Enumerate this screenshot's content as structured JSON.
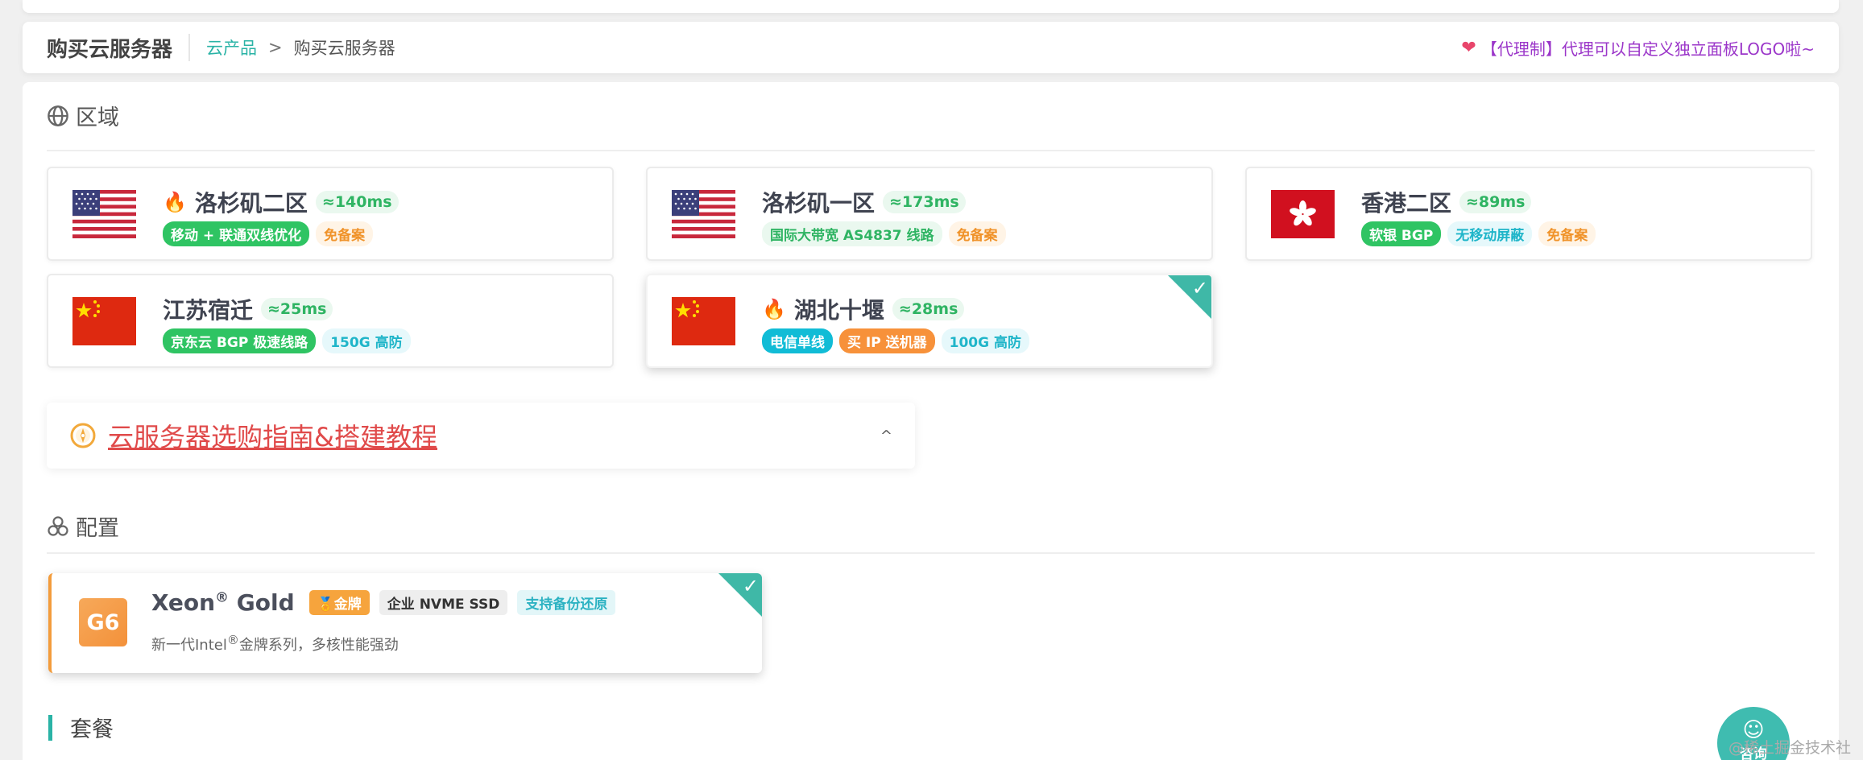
{
  "header": {
    "title": "购买云服务器",
    "breadcrumb_link": "云产品",
    "breadcrumb_arrow": ">",
    "breadcrumb_current": "购买云服务器",
    "promo": "【代理制】代理可以自定义独立面板LOGO啦~"
  },
  "region_section": {
    "title": "区域",
    "regions": [
      {
        "name": "洛杉矶二区",
        "latency": "≈140ms",
        "hot": true,
        "flag": "us",
        "tags": [
          {
            "text": "移动 + 联通双线优化",
            "style": "green"
          },
          {
            "text": "免备案",
            "style": "orange-lt"
          }
        ]
      },
      {
        "name": "洛杉矶一区",
        "latency": "≈173ms",
        "hot": false,
        "flag": "us",
        "tags": [
          {
            "text": "国际大带宽 AS4837 线路",
            "style": "green-lt"
          },
          {
            "text": "免备案",
            "style": "orange-lt"
          }
        ]
      },
      {
        "name": "香港二区",
        "latency": "≈89ms",
        "hot": false,
        "flag": "hk",
        "tags": [
          {
            "text": "软银 BGP",
            "style": "green"
          },
          {
            "text": "无移动屏蔽",
            "style": "cyan-lt"
          },
          {
            "text": "免备案",
            "style": "orange-lt"
          }
        ]
      },
      {
        "name": "江苏宿迁",
        "latency": "≈25ms",
        "hot": false,
        "flag": "cn",
        "tags": [
          {
            "text": "京东云 BGP 极速线路",
            "style": "green"
          },
          {
            "text": "150G 高防",
            "style": "cyan-lt"
          }
        ]
      },
      {
        "name": "湖北十堰",
        "latency": "≈28ms",
        "hot": true,
        "flag": "cn",
        "selected": true,
        "tags": [
          {
            "text": "电信单线",
            "style": "cyan"
          },
          {
            "text": "买 IP 送机器",
            "style": "orange"
          },
          {
            "text": "100G 高防",
            "style": "cyan-lt"
          }
        ]
      }
    ]
  },
  "guide": {
    "link_text": "云服务器选购指南&搭建教程",
    "chevron": "^"
  },
  "config_section": {
    "title": "配置",
    "config": {
      "badge": "G6",
      "name": "Xeon",
      "name_sup": "®",
      "name_suffix": " Gold",
      "tag_gold": "金牌",
      "tag_ssd": "企业 NVME SSD",
      "tag_backup": "支持备份还原",
      "desc_pre": "新一代Intel",
      "desc_sup": "®",
      "desc_post": "金牌系列，多核性能强劲"
    }
  },
  "package_section": {
    "title": "套餐"
  },
  "consult": {
    "label": "咨询"
  },
  "watermark": "@稀土掘金技术社区",
  "colors": {
    "accent": "#2ab3a6",
    "promo": "#9b36c9",
    "guide_link": "#e04a4a",
    "selected_corner": "#3fb8a7"
  }
}
